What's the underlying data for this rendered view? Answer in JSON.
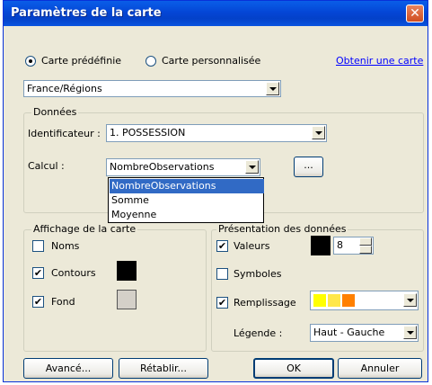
{
  "window": {
    "title": "Paramètres de la carte",
    "close_label": "✕"
  },
  "map_type": {
    "option_predefined": "Carte prédéfinie",
    "option_custom": "Carte personnalisée",
    "selected": "predefined",
    "get_map_link": "Obtenir une carte",
    "map_select_value": "France/Régions"
  },
  "donnees": {
    "group_label": "Données",
    "identifier_label": "Identificateur :",
    "identifier_value": "1. POSSESSION",
    "calcul_label": "Calcul :",
    "calcul_value": "NombreObservations",
    "calcul_options": [
      "NombreObservations",
      "Somme",
      "Moyenne"
    ],
    "calcul_selected_index": 0,
    "ellipsis_button": "..."
  },
  "affichage": {
    "group_label": "Affichage de la carte",
    "noms_label": "Noms",
    "noms_checked": false,
    "contours_label": "Contours",
    "contours_checked": true,
    "contours_color": "#000000",
    "fond_label": "Fond",
    "fond_checked": true,
    "fond_color": "#D4D0C8",
    "check_mark": "✔"
  },
  "presentation": {
    "group_label": "Présentation des données",
    "valeurs_label": "Valeurs",
    "valeurs_checked": true,
    "valeurs_color": "#000000",
    "valeurs_size": "8",
    "symboles_label": "Symboles",
    "symboles_checked": false,
    "remplissage_label": "Remplissage",
    "remplissage_checked": true,
    "remplissage_colors": [
      "#FFFF00",
      "#FFE74A",
      "#FF8000"
    ],
    "legende_label": "Légende :",
    "legende_value": "Haut - Gauche"
  },
  "buttons": {
    "advanced": "Avancé...",
    "reset": "Rétablir...",
    "ok": "OK",
    "cancel": "Annuler"
  }
}
